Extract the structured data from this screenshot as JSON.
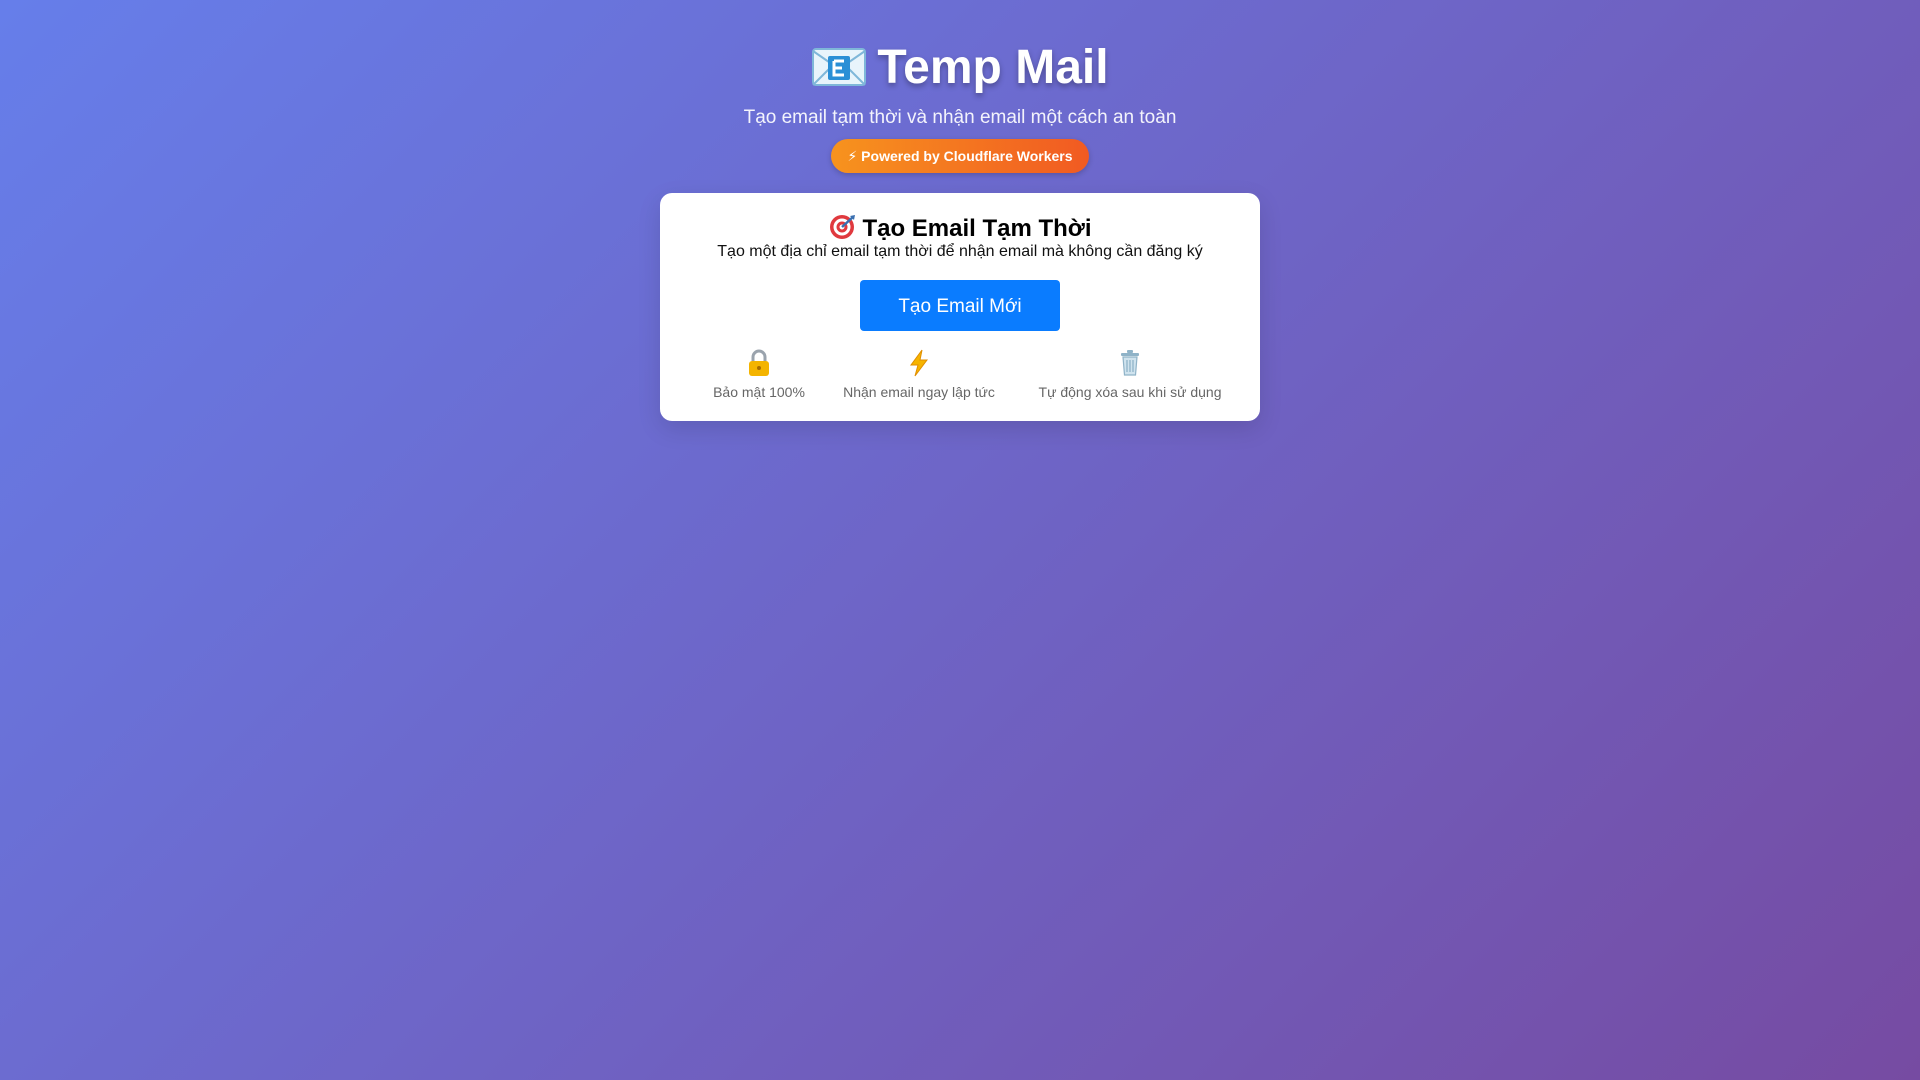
{
  "header": {
    "title": "Temp Mail",
    "subtitle": "Tạo email tạm thời và nhận email một cách an toàn",
    "badge": "⚡ Powered by Cloudflare Workers",
    "title_icon": "envelope-icon"
  },
  "card": {
    "title_icon": "target-icon",
    "title": "Tạo Email Tạm Thời",
    "description": "Tạo một địa chỉ email tạm thời để nhận email mà không cần đăng ký",
    "button_label": "Tạo Email Mới",
    "features": [
      {
        "icon": "lock-icon",
        "label": "Bảo mật 100%"
      },
      {
        "icon": "lightning-icon",
        "label": "Nhận email ngay lập tức"
      },
      {
        "icon": "trash-icon",
        "label": "Tự động xóa sau khi sử dụng"
      }
    ]
  },
  "colors": {
    "background_start": "#667eea",
    "background_end": "#764ba2",
    "badge_start": "#f7931e",
    "badge_end": "#f15a22",
    "button": "#0a7cff",
    "card": "#ffffff"
  }
}
